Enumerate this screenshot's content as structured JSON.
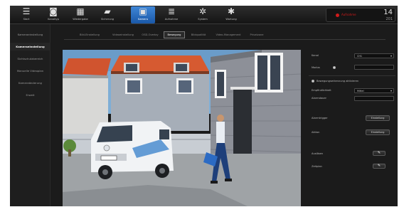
{
  "toolbar": {
    "items": [
      {
        "label": "Start",
        "icon": "menu-icon",
        "glyph": "☰"
      },
      {
        "label": "Kanaltyp",
        "icon": "camera-icon",
        "glyph": "◙"
      },
      {
        "label": "Wiedergabe",
        "icon": "film-icon",
        "glyph": "▦"
      },
      {
        "label": "Sicherung",
        "icon": "folder-icon",
        "glyph": "▰"
      },
      {
        "label": "Kamera",
        "icon": "camera-settings-icon",
        "glyph": "▣"
      },
      {
        "label": "Aufnahme",
        "icon": "hdd-icon",
        "glyph": "≣"
      },
      {
        "label": "System",
        "icon": "gear-icon",
        "glyph": "✲"
      },
      {
        "label": "Wartung",
        "icon": "wrench-icon",
        "glyph": "✱"
      }
    ],
    "active_index": 4,
    "status": {
      "rec_label": "Aufnahme",
      "time": "14",
      "date": "201"
    }
  },
  "sidebar": {
    "items": [
      "Kameraeinstellung",
      "Kameraeinstellung",
      "Sichtschutzbereich",
      "Manuelle Videoplan",
      "Kameraänderung",
      "Erweit"
    ],
    "active_index": 1
  },
  "tabs": {
    "items": [
      "Bild-Einstellung",
      "Videoeinstellung",
      "OSD-Overlay",
      "Bewegung",
      "Bildqualität",
      "Video-Management",
      "Privatzone"
    ],
    "active_index": 3
  },
  "panel": {
    "fields": [
      {
        "label": "Kanal",
        "value": "CH1"
      },
      {
        "label": "Modus"
      }
    ],
    "radio_label": "Bewegungserkennung aktivieren",
    "rows": [
      {
        "label": "Empfindlichkeit",
        "value": "Mittel"
      },
      {
        "label": "Alarmdauer"
      }
    ],
    "buttons": [
      {
        "label": "Alarmtrigger",
        "button": "Einstellung"
      },
      {
        "label": "Aktion",
        "button": "Einstellung"
      }
    ],
    "icon_rows": [
      {
        "label": "Auslösen",
        "icon": "edit-icon"
      },
      {
        "label": "Zeitplan",
        "icon": "edit-icon"
      }
    ]
  },
  "colors": {
    "active_tab": "#2f78cf",
    "record": "#d11b1b",
    "background": "#1b1b1b"
  }
}
